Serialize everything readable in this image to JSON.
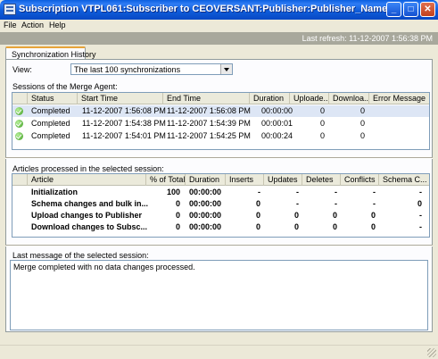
{
  "window": {
    "title": "Subscription VTPL061:Subscriber to CEOVERSANT:Publisher:Publisher_Name",
    "minimize": "_",
    "maximize": "□",
    "close": "✕"
  },
  "menu": {
    "file": "File",
    "action": "Action",
    "help": "Help"
  },
  "refresh": {
    "text": "Last refresh: 11-12-2007 1:56:38 PM"
  },
  "tab": {
    "label": "Synchronization History"
  },
  "view": {
    "label": "View:",
    "selected": "The last 100 synchronizations"
  },
  "sessions": {
    "label": "Sessions of the Merge Agent:",
    "columns": [
      "Status",
      "Start Time",
      "End Time",
      "Duration",
      "Uploade...",
      "Downloa...",
      "Error Message"
    ],
    "rows": [
      {
        "status": "Completed",
        "start": "11-12-2007 1:56:08 PM",
        "end": "11-12-2007 1:56:08 PM",
        "duration": "00:00:00",
        "uploaded": "0",
        "downloaded": "0",
        "error": ""
      },
      {
        "status": "Completed",
        "start": "11-12-2007 1:54:38 PM",
        "end": "11-12-2007 1:54:39 PM",
        "duration": "00:00:01",
        "uploaded": "0",
        "downloaded": "0",
        "error": ""
      },
      {
        "status": "Completed",
        "start": "11-12-2007 1:54:01 PM",
        "end": "11-12-2007 1:54:25 PM",
        "duration": "00:00:24",
        "uploaded": "0",
        "downloaded": "0",
        "error": ""
      }
    ]
  },
  "articles": {
    "label": "Articles processed in the selected session:",
    "columns": [
      "Article",
      "% of Total",
      "Duration",
      "Inserts",
      "Updates",
      "Deletes",
      "Conflicts",
      "Schema C..."
    ],
    "rows": [
      {
        "article": "Initialization",
        "pct": "100",
        "duration": "00:00:00",
        "inserts": "-",
        "updates": "-",
        "deletes": "-",
        "conflicts": "-",
        "schema": "-"
      },
      {
        "article": "Schema changes and bulk in...",
        "pct": "0",
        "duration": "00:00:00",
        "inserts": "0",
        "updates": "-",
        "deletes": "-",
        "conflicts": "-",
        "schema": "0"
      },
      {
        "article": "Upload changes to Publisher",
        "pct": "0",
        "duration": "00:00:00",
        "inserts": "0",
        "updates": "0",
        "deletes": "0",
        "conflicts": "0",
        "schema": "-"
      },
      {
        "article": "Download changes to Subsc...",
        "pct": "0",
        "duration": "00:00:00",
        "inserts": "0",
        "updates": "0",
        "deletes": "0",
        "conflicts": "0",
        "schema": "-"
      }
    ]
  },
  "lastMessage": {
    "label": "Last message of the selected session:",
    "text": "Merge completed with no data changes processed."
  }
}
